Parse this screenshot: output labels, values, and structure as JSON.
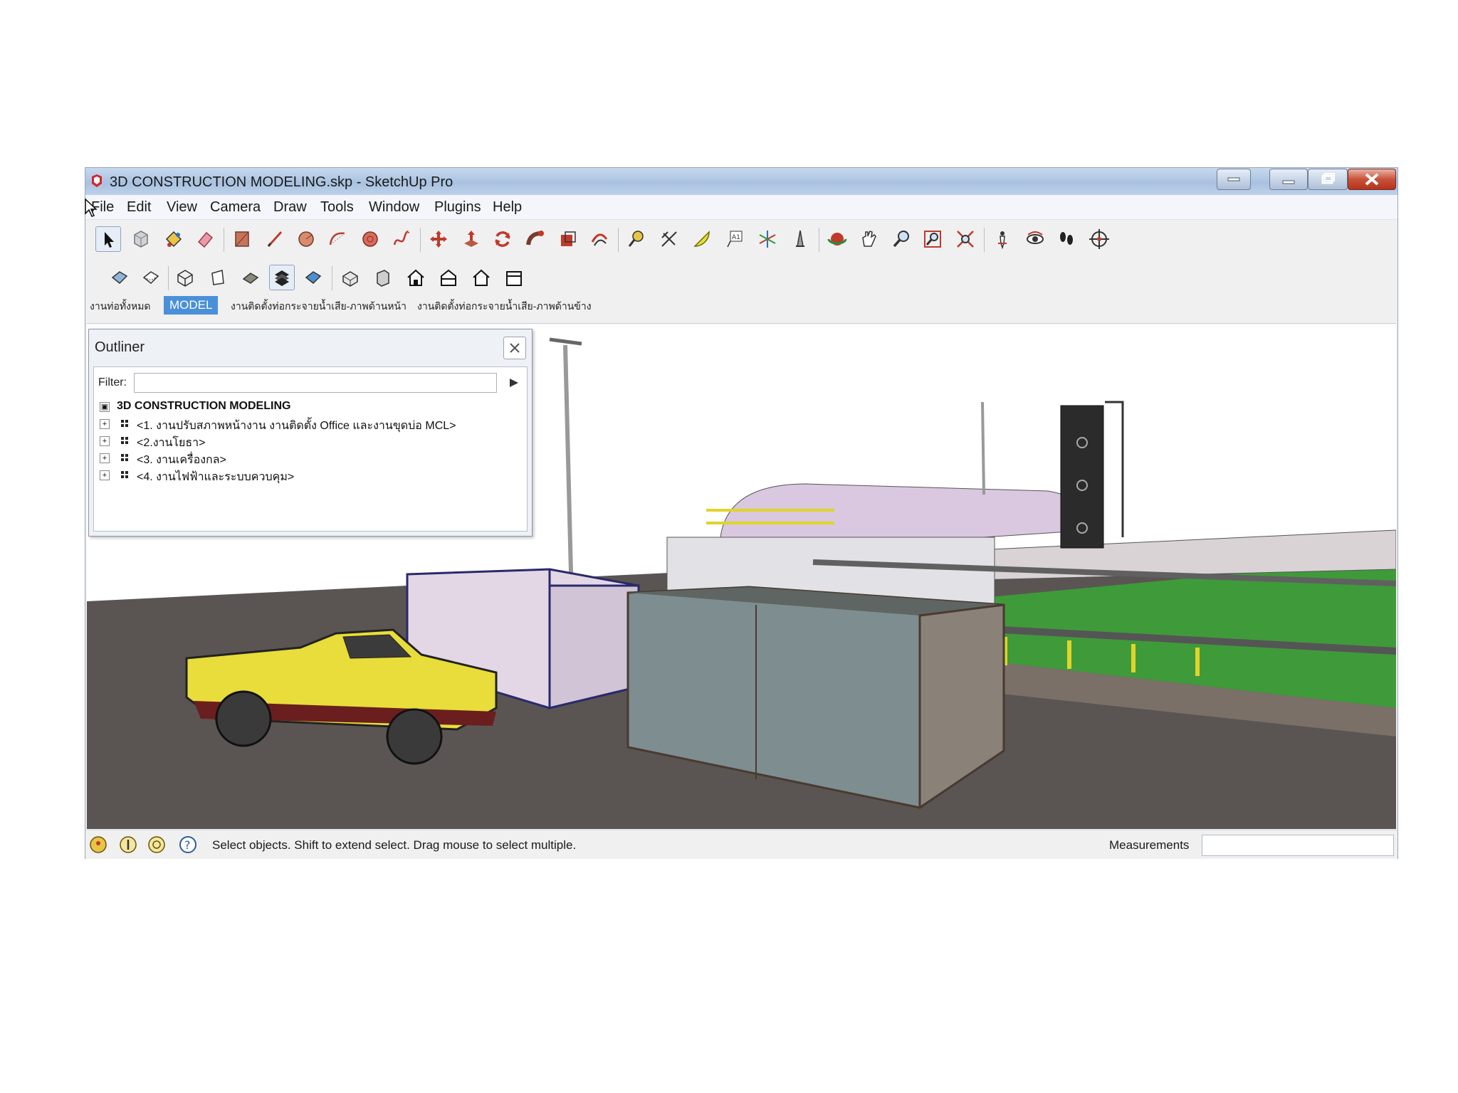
{
  "window": {
    "title": "3D CONSTRUCTION MODELING.skp - SketchUp Pro"
  },
  "menu": [
    "File",
    "Edit",
    "View",
    "Camera",
    "Draw",
    "Tools",
    "Window",
    "Plugins",
    "Help"
  ],
  "toolbar_primary": [
    "select-icon",
    "make-component-icon",
    "paint-bucket-icon",
    "eraser-icon",
    "rectangle-icon",
    "line-icon",
    "circle-icon",
    "arc-icon",
    "polygon-icon",
    "freehand-icon",
    "move-icon",
    "push-pull-icon",
    "rotate-icon",
    "follow-me-icon",
    "scale-icon",
    "offset-icon",
    "tape-measure-icon",
    "dimension-icon",
    "protractor-icon",
    "text-icon",
    "axes-icon",
    "3d-text-icon",
    "orbit-icon",
    "pan-icon",
    "zoom-icon",
    "zoom-window-icon",
    "zoom-extents-icon",
    "position-camera-icon",
    "look-around-icon",
    "walk-icon",
    "section-plane-icon"
  ],
  "toolbar_secondary": [
    "xray-icon",
    "back-edges-icon",
    "wireframe-icon",
    "hidden-line-icon",
    "shaded-icon",
    "shaded-textures-icon",
    "monochrome-icon",
    "iso-view-icon",
    "top-view-icon",
    "front-view-icon",
    "right-view-icon",
    "back-view-icon",
    "left-view-icon"
  ],
  "scene_tabs": [
    "งานท่อทั้งหมด",
    "MODEL",
    "งานติดตั้งท่อกระจายน้ำเสีย-ภาพด้านหน้า",
    "งานติดตั้งท่อกระจายน้ำเสีย-ภาพด้านข้าง"
  ],
  "outliner": {
    "title": "Outliner",
    "filter_label": "Filter:",
    "filter_value": "",
    "root": "3D CONSTRUCTION MODELING",
    "items": [
      "<1. งานปรับสภาพหน้างาน งานติดตั้ง Office และงานขุดบ่อ MCL>",
      "<2.งานโยธา>",
      "<3. งานเครื่องกล>",
      "<4. งานไฟฟ้าและระบบควบคุม>"
    ]
  },
  "status": {
    "message": "Select objects. Shift to extend select. Drag mouse to select multiple.",
    "measurements_label": "Measurements",
    "measurements_value": ""
  },
  "colors": {
    "active_tab": "#4a90d9",
    "truck": "#e8dd3a",
    "ground": "#5a5553",
    "grass": "#3f9a3a"
  }
}
